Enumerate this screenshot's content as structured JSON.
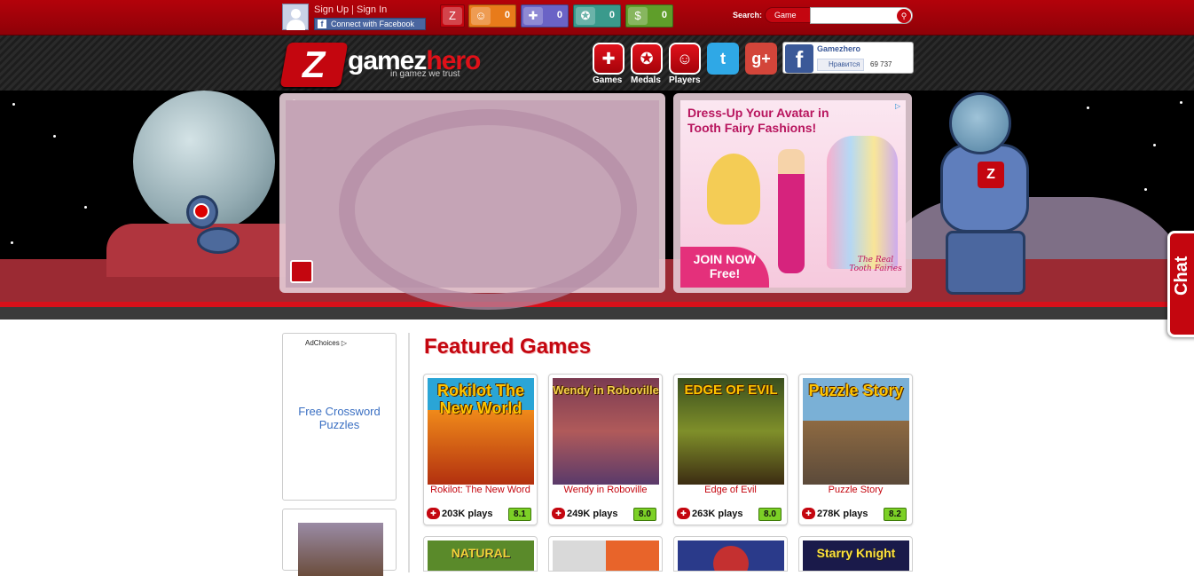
{
  "colors": {
    "brand_red": "#c4060f",
    "topbar": "#b3020a",
    "rating_green": "#7cd026",
    "link_blue": "#3a6fc2"
  },
  "topbar": {
    "sign_up": "Sign Up",
    "separator": "|",
    "sign_in": "Sign In",
    "fb_connect": "Connect with Facebook",
    "counters": [
      {
        "icon": "gamezhero-icon",
        "value": ""
      },
      {
        "icon": "smiley-icon",
        "value": "0"
      },
      {
        "icon": "gamepad-icon",
        "value": "0"
      },
      {
        "icon": "medal-icon",
        "value": "0"
      },
      {
        "icon": "money-icon",
        "value": "0"
      }
    ],
    "search_label": "Search:",
    "search_scope": "Game",
    "search_value": ""
  },
  "header": {
    "logo_left": "gamez",
    "logo_right": "hero",
    "tagline": "in gamez we trust",
    "nav": [
      {
        "label": "Games",
        "icon": "gamepad-icon"
      },
      {
        "label": "Medals",
        "icon": "medal-icon"
      },
      {
        "label": "Players",
        "icon": "smiley-icon"
      }
    ],
    "social": [
      "twitter-icon",
      "google-plus-icon"
    ],
    "facebook_page": "Gamezhero",
    "facebook_like": "Нравится",
    "facebook_count": "69 737"
  },
  "banner_ad": {
    "headline": "Dress-Up Your Avatar in Tooth Fairy Fashions!",
    "cta": "JOIN NOW Free!",
    "signature": "The Real Tooth Fairies"
  },
  "chat_label": "Chat",
  "sidebar": {
    "adchoices": "AdChoices",
    "ad_link": "Free Crossword Puzzles"
  },
  "featured": {
    "title": "Featured Games",
    "games": [
      {
        "title": "Rokilot: The New Word",
        "thumb_text": "Rokilot The New World",
        "plays": "203K plays",
        "rating": "8.1"
      },
      {
        "title": "Wendy in Roboville",
        "thumb_text": "Wendy in Roboville",
        "plays": "249K plays",
        "rating": "8.0"
      },
      {
        "title": "Edge of Evil",
        "thumb_text": "EDGE OF EVIL",
        "plays": "263K plays",
        "rating": "8.0"
      },
      {
        "title": "Puzzle Story",
        "thumb_text": "Puzzle Story",
        "plays": "278K plays",
        "rating": "8.2"
      }
    ],
    "row2": [
      {
        "thumb_text": "NATURAL"
      },
      {
        "thumb_text": ""
      },
      {
        "thumb_text": ""
      },
      {
        "thumb_text": "Starry Knight"
      }
    ]
  }
}
